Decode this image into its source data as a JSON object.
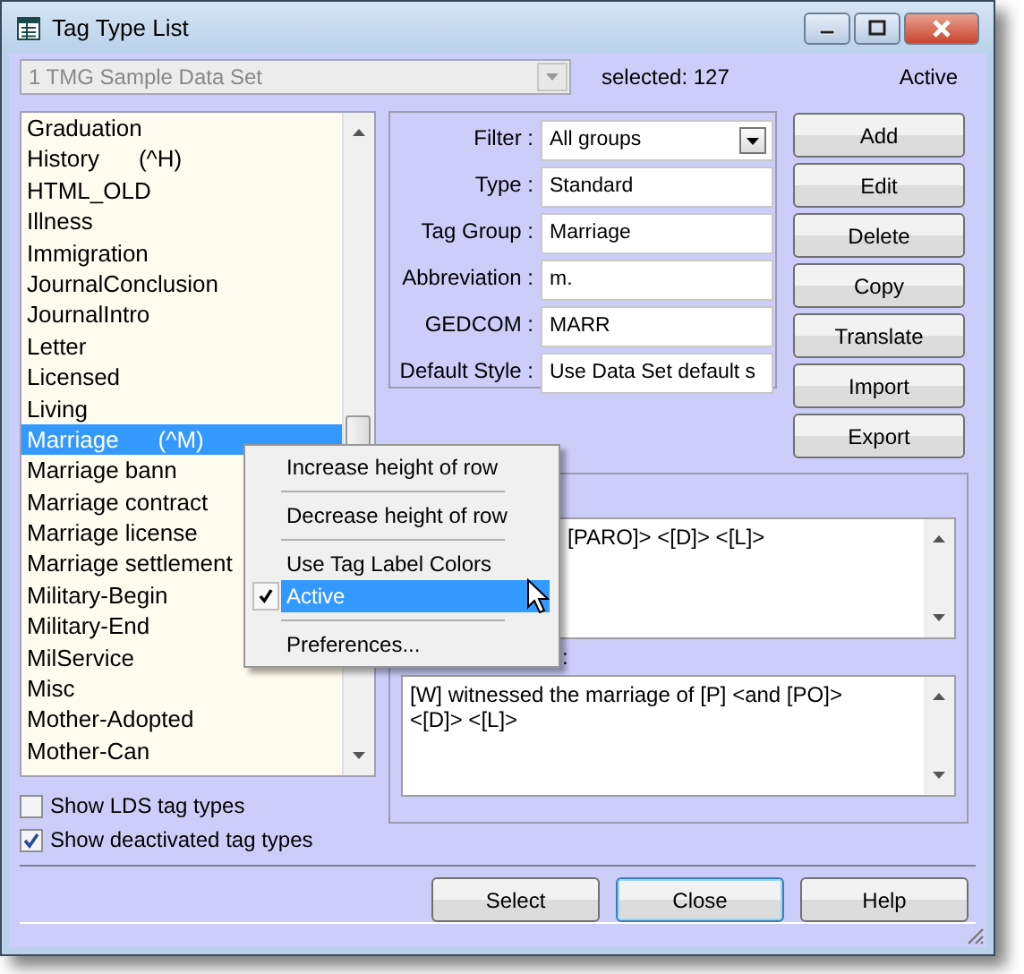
{
  "window": {
    "title": "Tag Type List"
  },
  "data_set": {
    "value": "1 TMG Sample Data Set",
    "disabled": true
  },
  "selected_count": "selected: 127",
  "status": "Active",
  "tag_types": [
    {
      "label": "Graduation",
      "selected": false
    },
    {
      "label": "History",
      "shortcut": "(^H)",
      "selected": false
    },
    {
      "label": "HTML_OLD",
      "selected": false
    },
    {
      "label": "Illness",
      "selected": false
    },
    {
      "label": "Immigration",
      "selected": false
    },
    {
      "label": "JournalConclusion",
      "selected": false
    },
    {
      "label": "JournalIntro",
      "selected": false
    },
    {
      "label": "Letter",
      "selected": false
    },
    {
      "label": "Licensed",
      "selected": false
    },
    {
      "label": "Living",
      "selected": false
    },
    {
      "label": "Marriage",
      "shortcut": "(^M)",
      "selected": true
    },
    {
      "label": "Marriage bann",
      "selected": false
    },
    {
      "label": "Marriage contract",
      "selected": false
    },
    {
      "label": "Marriage license",
      "selected": false
    },
    {
      "label": "Marriage settlement",
      "selected": false
    },
    {
      "label": "Military-Begin",
      "selected": false
    },
    {
      "label": "Military-End",
      "selected": false
    },
    {
      "label": "MilService",
      "selected": false
    },
    {
      "label": "Misc",
      "selected": false
    },
    {
      "label": "Mother-Adopted",
      "selected": false
    },
    {
      "label": "Mother-Can",
      "selected": false
    }
  ],
  "options": [
    {
      "label": "Show LDS tag types",
      "checked": false
    },
    {
      "label": "Show deactivated tag types",
      "checked": true
    }
  ],
  "details": [
    {
      "kind": "dropdown",
      "label": "Filter :",
      "value": "All groups"
    },
    {
      "kind": "field",
      "label": "Type :",
      "value": "Standard"
    },
    {
      "kind": "field",
      "label": "Tag Group :",
      "value": "Marriage"
    },
    {
      "kind": "field",
      "label": "Abbreviation :",
      "value": "m."
    },
    {
      "kind": "field",
      "label": "GEDCOM :",
      "value": "MARR"
    },
    {
      "kind": "field",
      "label": "Default Style :",
      "value": "Use Data Set default s"
    }
  ],
  "actions": [
    "Add",
    "Edit",
    "Delete",
    "Copy",
    "Translate",
    "Import",
    "Export"
  ],
  "sentences": [
    {
      "value": "[PARO]> <[D]> <[L]>"
    },
    {
      "label": ":",
      "value": "[W] witnessed the marriage of [P] <and [PO]> <[D]> <[L]>"
    }
  ],
  "context_menu": [
    {
      "kind": "item",
      "label": "Increase height of row",
      "checked": false,
      "selected": false
    },
    {
      "kind": "separator"
    },
    {
      "kind": "item",
      "label": "Decrease height of row",
      "checked": false,
      "selected": false
    },
    {
      "kind": "separator"
    },
    {
      "kind": "item",
      "label": "Use Tag Label Colors",
      "checked": false,
      "selected": false
    },
    {
      "kind": "item",
      "label": "Active",
      "checked": true,
      "selected": true
    },
    {
      "kind": "separator"
    },
    {
      "kind": "item",
      "label": "Preferences...",
      "checked": false,
      "selected": false
    }
  ],
  "footer_buttons": [
    {
      "label": "Select",
      "default": false
    },
    {
      "label": "Close",
      "default": true
    },
    {
      "label": "Help",
      "default": false
    }
  ]
}
